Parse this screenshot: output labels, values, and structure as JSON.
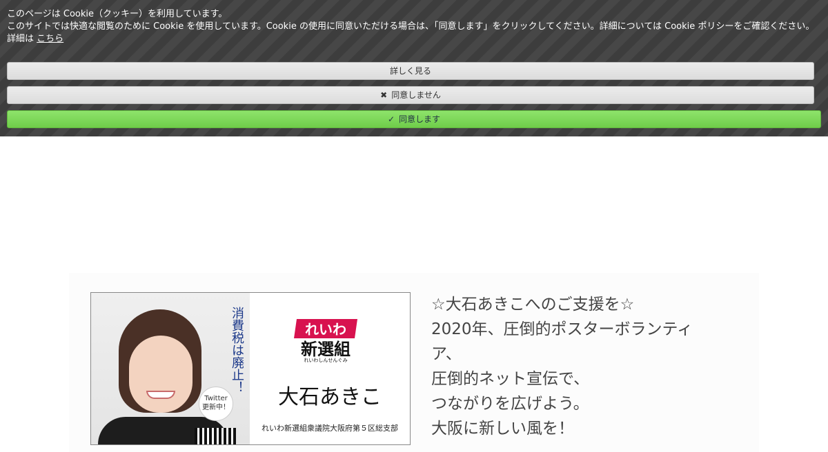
{
  "cookie": {
    "heading": "このページは Cookie（クッキー）を利用しています。",
    "body": "このサイトでは快適な閲覧のために Cookie を使用しています。Cookie の使用に同意いただける場合は、「同意します」をクリックしてください。詳細については Cookie ポリシーをご確認ください。",
    "details_prefix": "詳細は",
    "details_link": "こちら",
    "more_button": "詳しく見る",
    "decline_button": "同意しません",
    "accept_button": "同意します",
    "decline_icon": "✖",
    "accept_icon": "✓"
  },
  "banner": {
    "vertical_text": "消費税は廃止！",
    "twitter_line1": "Twitter",
    "twitter_line2": "更新中！",
    "logo_top": "れいわ",
    "logo_main": "新選組",
    "logo_sub": "れいわしんせんぐみ",
    "candidate_name": "大石あきこ",
    "org": "れいわ新選組衆議院大阪府第５区総支部"
  },
  "message": {
    "lines": [
      "☆大石あきこへのご支援を☆",
      "2020年、圧倒的ポスターボランティ",
      "ア、",
      "圧倒的ネット宣伝で、",
      "つながりを広げよう。",
      "大阪に新しい風を！"
    ]
  },
  "colors": {
    "cookie_bg": "#3d3d3d",
    "accept_green": "#7ad957",
    "brand_red": "#d8124f"
  }
}
